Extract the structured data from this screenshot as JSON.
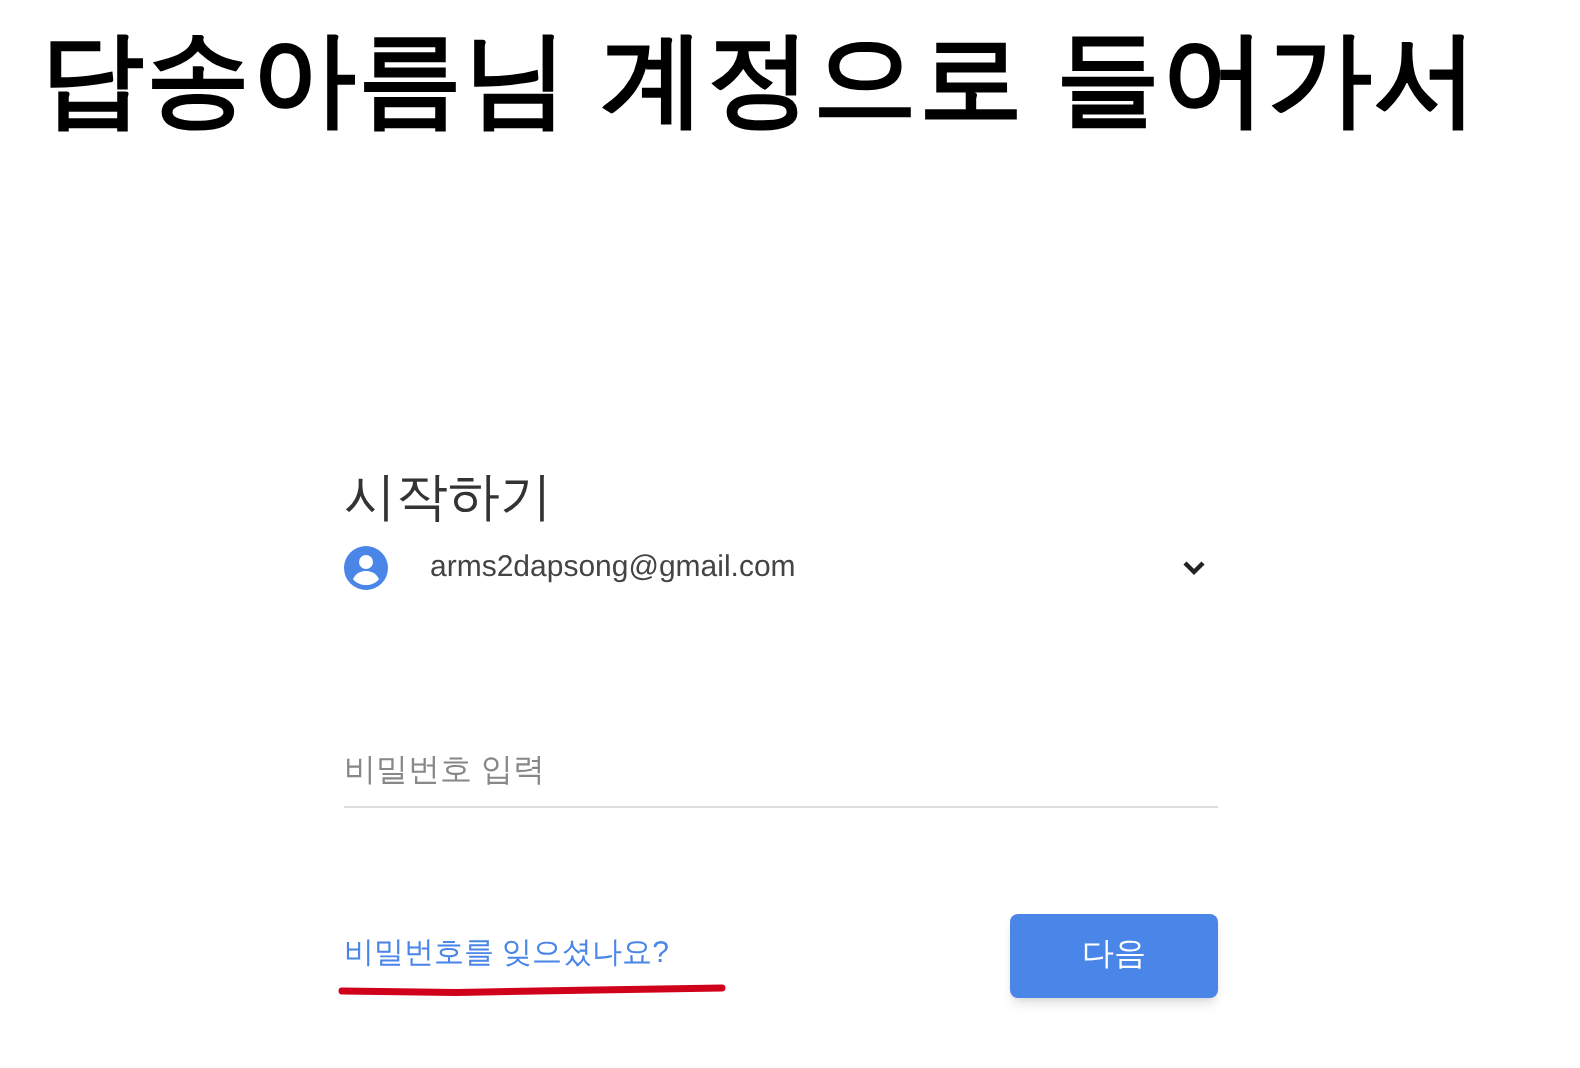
{
  "caption": "답송아름님 계정으로 들어가서",
  "login": {
    "heading": "시작하기",
    "account": {
      "email": "arms2dapsong@gmail.com"
    },
    "password_field": {
      "placeholder": "비밀번호 입력"
    },
    "forgot_link": "비밀번호를 잊으셨나요?",
    "next_button": "다음"
  }
}
